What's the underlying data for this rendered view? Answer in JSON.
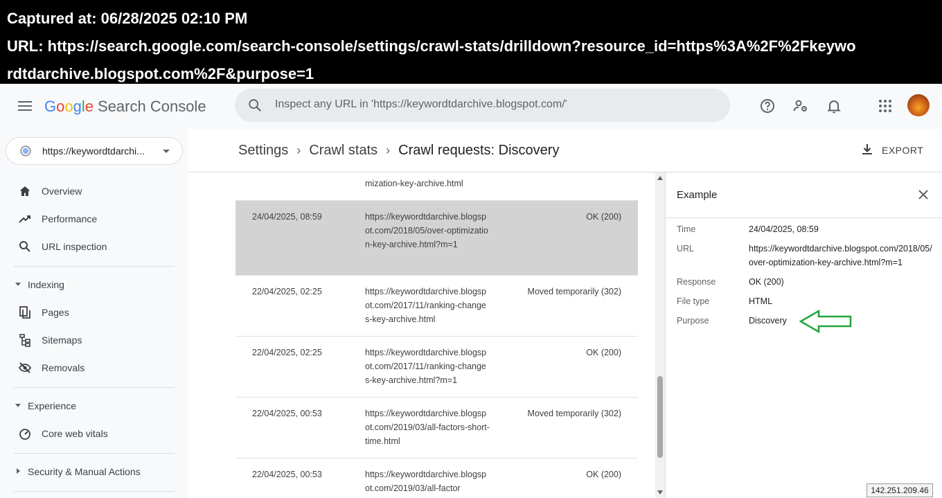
{
  "banner": {
    "captured": "Captured at: 06/28/2025 02:10 PM",
    "url_line1": "URL: https://search.google.com/search-console/settings/crawl-stats/drilldown?resource_id=https%3A%2F%2Fkeywo",
    "url_line2": "rdtdarchive.blogspot.com%2F&purpose=1"
  },
  "header": {
    "logo_g": "G",
    "logo_o1": "o",
    "logo_o2": "o",
    "logo_g2": "g",
    "logo_l": "l",
    "logo_e": "e",
    "product": "Search Console",
    "search_placeholder": "Inspect any URL in 'https://keywordtdarchive.blogspot.com/'"
  },
  "sidebar": {
    "property": "https://keywordtdarchi...",
    "items_top": [
      {
        "label": "Overview",
        "icon": "home-icon"
      },
      {
        "label": "Performance",
        "icon": "trending-up-icon"
      },
      {
        "label": "URL inspection",
        "icon": "search-icon"
      }
    ],
    "sections": {
      "indexing": "Indexing",
      "experience": "Experience",
      "security": "Security & Manual Actions"
    },
    "indexing_items": [
      {
        "label": "Pages",
        "icon": "pages-icon"
      },
      {
        "label": "Sitemaps",
        "icon": "sitemap-icon"
      },
      {
        "label": "Removals",
        "icon": "removals-icon"
      }
    ],
    "experience_items": [
      {
        "label": "Core web vitals",
        "icon": "speed-gauge-icon"
      }
    ]
  },
  "breadcrumb": {
    "settings": "Settings",
    "crawl_stats": "Crawl stats",
    "current": "Crawl requests: Discovery"
  },
  "toolbar": {
    "export_label": "EXPORT"
  },
  "table": {
    "partial_row_url": "mization-key-archive.html",
    "rows": [
      {
        "time": "24/04/2025, 08:59",
        "url": "https://keywordtdarchive.blogspot.com/2018/05/over-optimization-key-archive.html?m=1",
        "response": "OK (200)",
        "selected": true
      },
      {
        "time": "22/04/2025, 02:25",
        "url": "https://keywordtdarchive.blogspot.com/2017/11/ranking-changes-key-archive.html",
        "response": "Moved temporarily (302)"
      },
      {
        "time": "22/04/2025, 02:25",
        "url": "https://keywordtdarchive.blogspot.com/2017/11/ranking-changes-key-archive.html?m=1",
        "response": "OK (200)"
      },
      {
        "time": "22/04/2025, 00:53",
        "url": "https://keywordtdarchive.blogspot.com/2019/03/all-factors-short-time.html",
        "response": "Moved temporarily (302)"
      },
      {
        "time": "22/04/2025, 00:53",
        "url": "https://keywordtdarchive.blogspot.com/2019/03/all-factor",
        "response": "OK (200)"
      }
    ]
  },
  "panel": {
    "title": "Example",
    "rows": [
      {
        "key": "Time",
        "value": "24/04/2025, 08:59"
      },
      {
        "key": "URL",
        "value": "https://keywordtdarchive.blogspot.com/2018/05/over-optimization-key-archive.html?m=1"
      },
      {
        "key": "Response",
        "value": "OK (200)"
      },
      {
        "key": "File type",
        "value": "HTML"
      },
      {
        "key": "Purpose",
        "value": "Discovery"
      }
    ]
  },
  "footer": {
    "ip": "142.251.209.46"
  },
  "colors": {
    "annotation_arrow": "#22a33a",
    "selected_row": "#d3d3d3"
  }
}
